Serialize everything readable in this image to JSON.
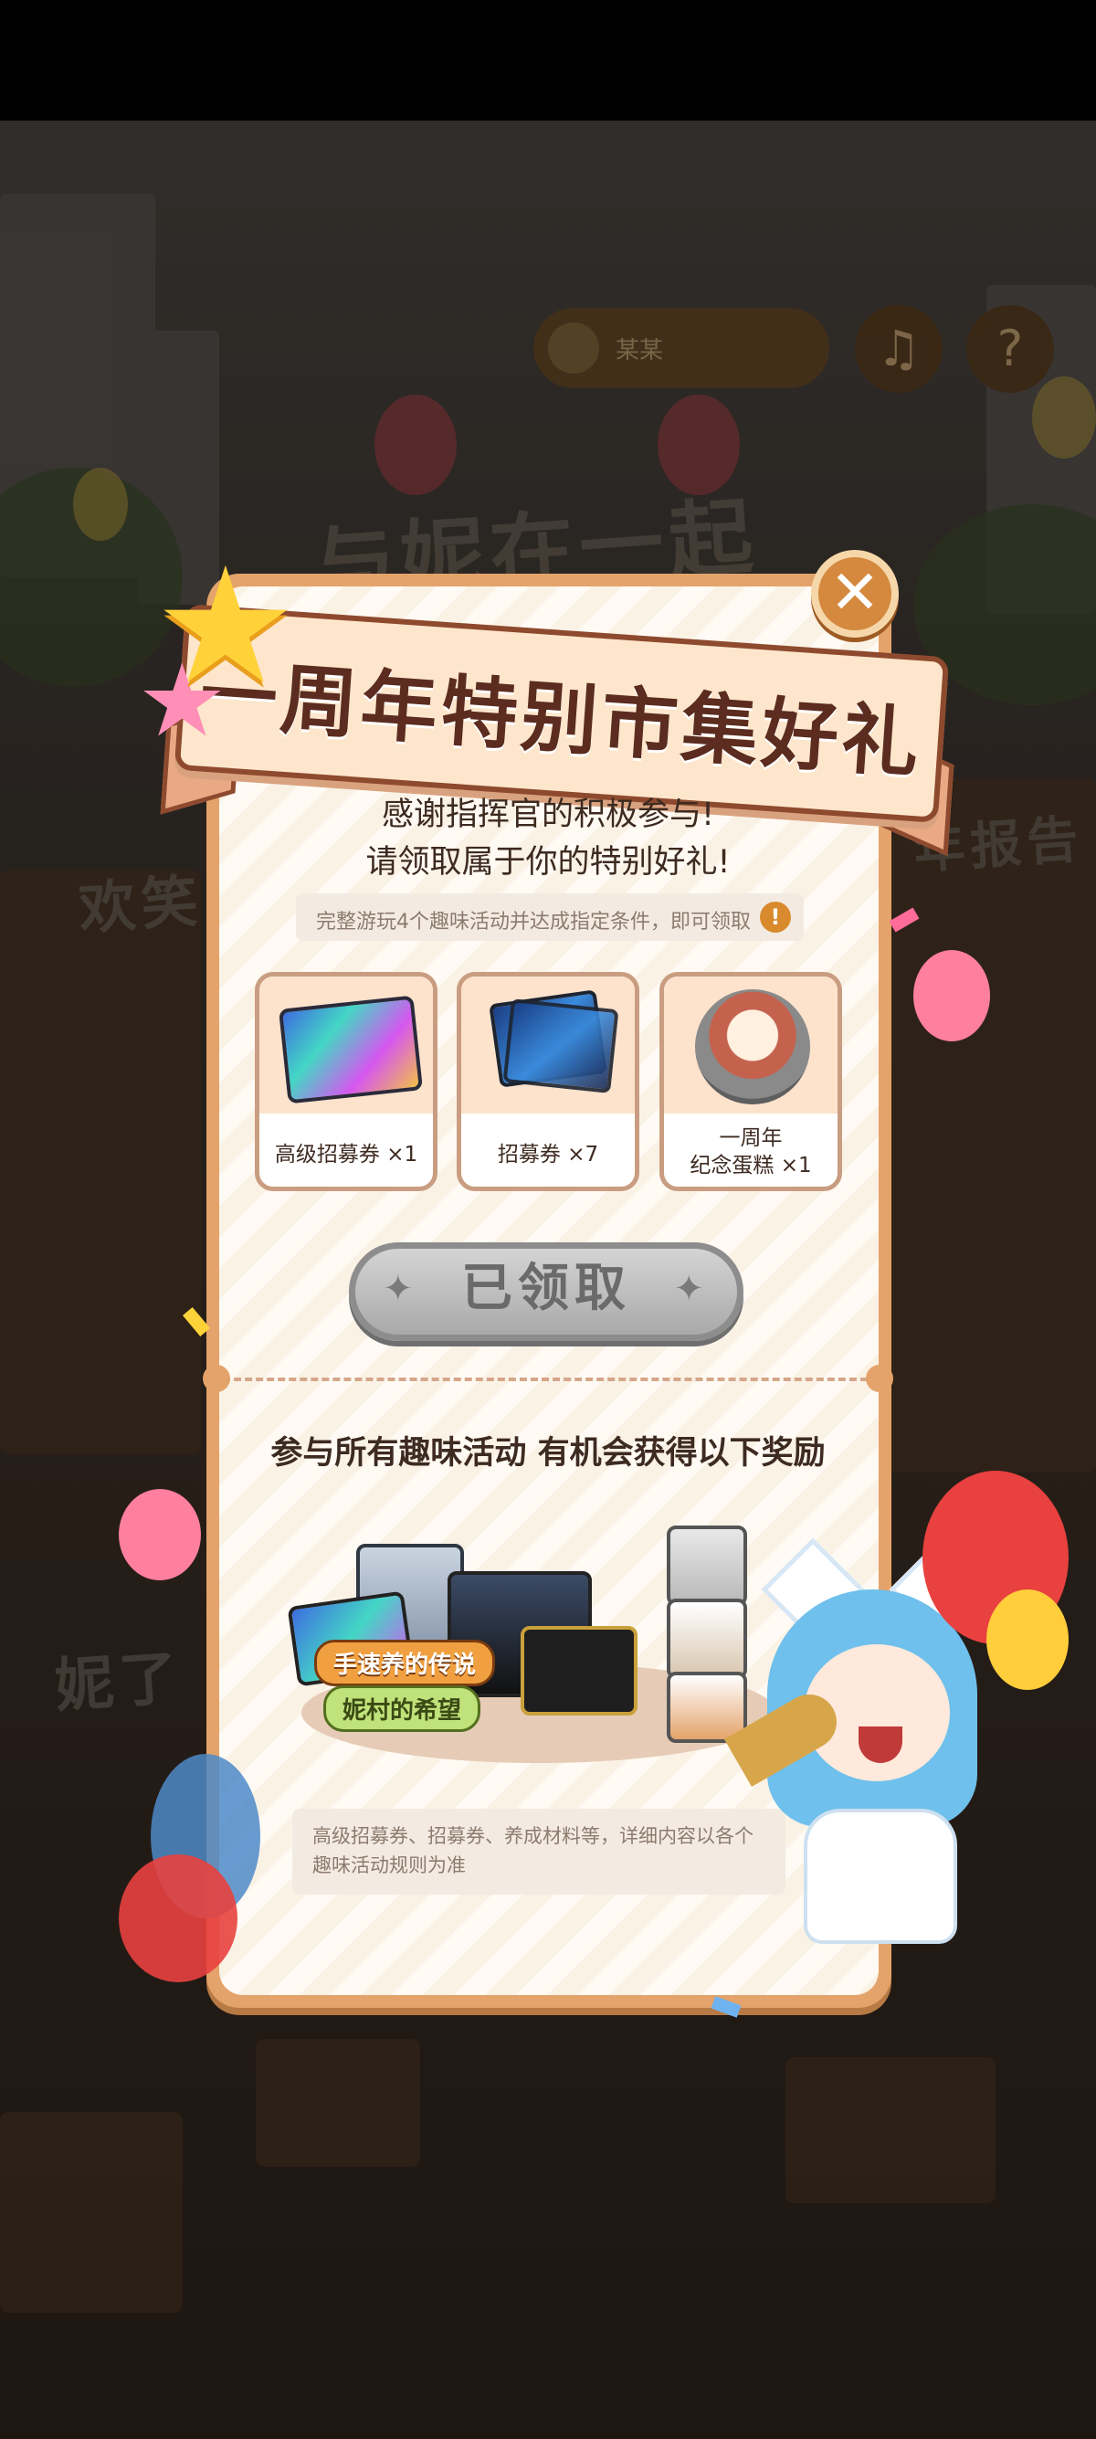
{
  "background": {
    "player_name": "某某",
    "music_icon": "music-note-icon",
    "help_icon": "question-mark-icon",
    "sign_text": "与妮在一起",
    "left_sign_text": "欢笑",
    "right_sign_text": "年报告",
    "lower_sign_text": "妮了"
  },
  "popup": {
    "title": "一周年特别市集好礼",
    "close_icon": "close-icon",
    "thanks_lines": [
      "感谢指挥官的积极参与!",
      "请领取属于你的特别好礼!"
    ],
    "notice": "完整游玩4个趣味活动并达成指定条件，即可领取",
    "notice_icon": "exclamation-icon",
    "rewards": [
      {
        "label": "高级招募券 ×1"
      },
      {
        "label": "招募券 ×7"
      },
      {
        "label_line1": "一周年",
        "label_line2": "纪念蛋糕 ×1"
      }
    ],
    "claimed_button": "已领取",
    "section_title": "参与所有趣味活动 有机会获得以下奖励",
    "art_labels": [
      "手速养的传说",
      "妮村的希望"
    ],
    "description": "高级招募券、招募券、养成材料等，详细内容以各个趣味活动规则为准"
  },
  "colors": {
    "panel_border": "#e4a36a",
    "banner_text": "#5b2c1f",
    "claimed_gray": "#a9a9a9",
    "warn_orange": "#d88a2d"
  }
}
